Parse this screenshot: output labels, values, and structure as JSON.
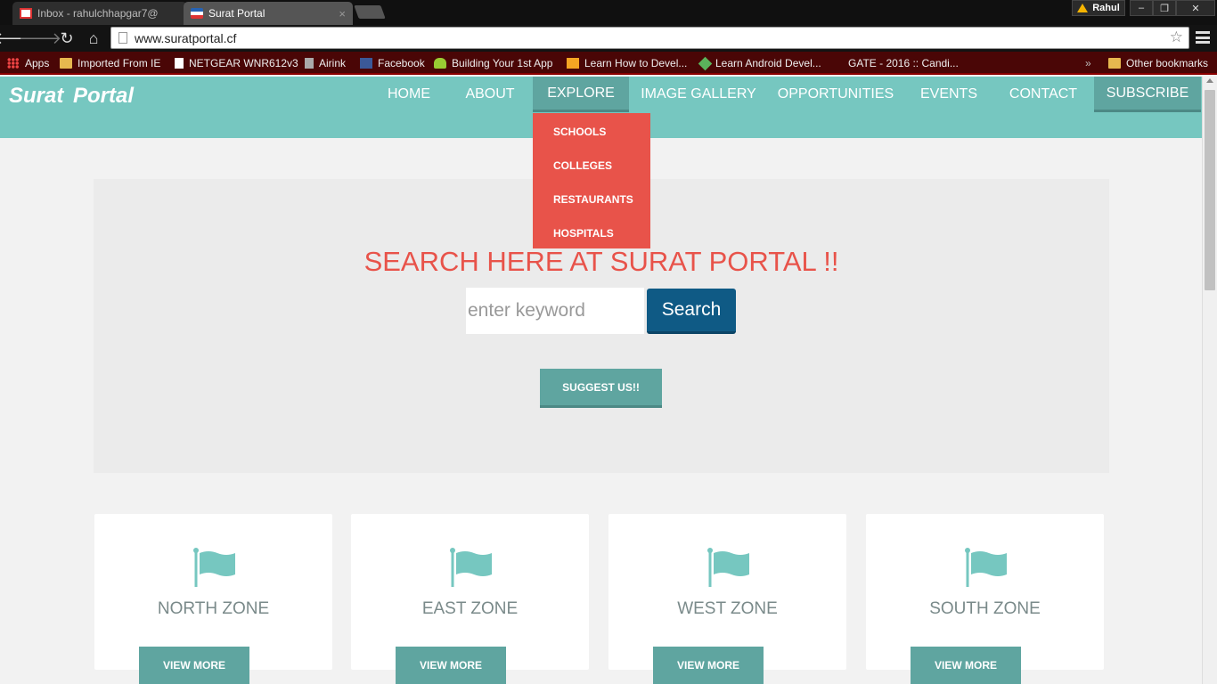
{
  "browser": {
    "tabs": [
      {
        "title": "Inbox - rahulchhapgar7@"
      },
      {
        "title": "Surat Portal"
      }
    ],
    "close_glyph": "×",
    "user": "Rahul",
    "url": "www.suratportal.cf",
    "bookmarks": [
      {
        "label": "Apps",
        "icon": "apps-icon"
      },
      {
        "label": "Imported From IE",
        "icon": "folder-icon"
      },
      {
        "label": "NETGEAR WNR612v3",
        "icon": "page-icon"
      },
      {
        "label": "Airink",
        "icon": "airink-icon"
      },
      {
        "label": "Facebook",
        "icon": "facebook-icon"
      },
      {
        "label": "Building Your 1st App",
        "icon": "android-icon"
      },
      {
        "label": "Learn How to Devel...",
        "icon": "amazon-icon"
      },
      {
        "label": "Learn Android Devel...",
        "icon": "hex-icon"
      },
      {
        "label": "GATE - 2016 :: Candi...",
        "icon": "page-icon"
      }
    ],
    "bookmarks_overflow": "»",
    "other_bookmarks": "Other bookmarks"
  },
  "site": {
    "brand": "Surat  Portal",
    "nav": [
      {
        "label": "HOME"
      },
      {
        "label": "ABOUT"
      },
      {
        "label": "EXPLORE"
      },
      {
        "label": "IMAGE GALLERY"
      },
      {
        "label": "OPPORTUNITIES"
      },
      {
        "label": "EVENTS"
      },
      {
        "label": "CONTACT"
      },
      {
        "label": "SUBSCRIBE"
      }
    ],
    "explore_dropdown": [
      "SCHOOLS",
      "COLLEGES",
      "RESTAURANTS",
      "HOSPITALS"
    ],
    "hero": {
      "title": "SEARCH HERE AT SURAT PORTAL !!",
      "search_placeholder": "enter keyword",
      "search_button": "Search",
      "suggest_button": "SUGGEST US!!"
    },
    "zones": [
      {
        "name": "NORTH ZONE",
        "button": "VIEW MORE"
      },
      {
        "name": "EAST ZONE",
        "button": "VIEW MORE"
      },
      {
        "name": "WEST ZONE",
        "button": "VIEW MORE"
      },
      {
        "name": "SOUTH ZONE",
        "button": "VIEW MORE"
      }
    ]
  },
  "colors": {
    "header_teal": "#76c7c0",
    "button_teal": "#5fa5a0",
    "accent_red": "#e8534a",
    "search_blue": "#0f5a85",
    "bookmark_bar": "#4a0606"
  }
}
